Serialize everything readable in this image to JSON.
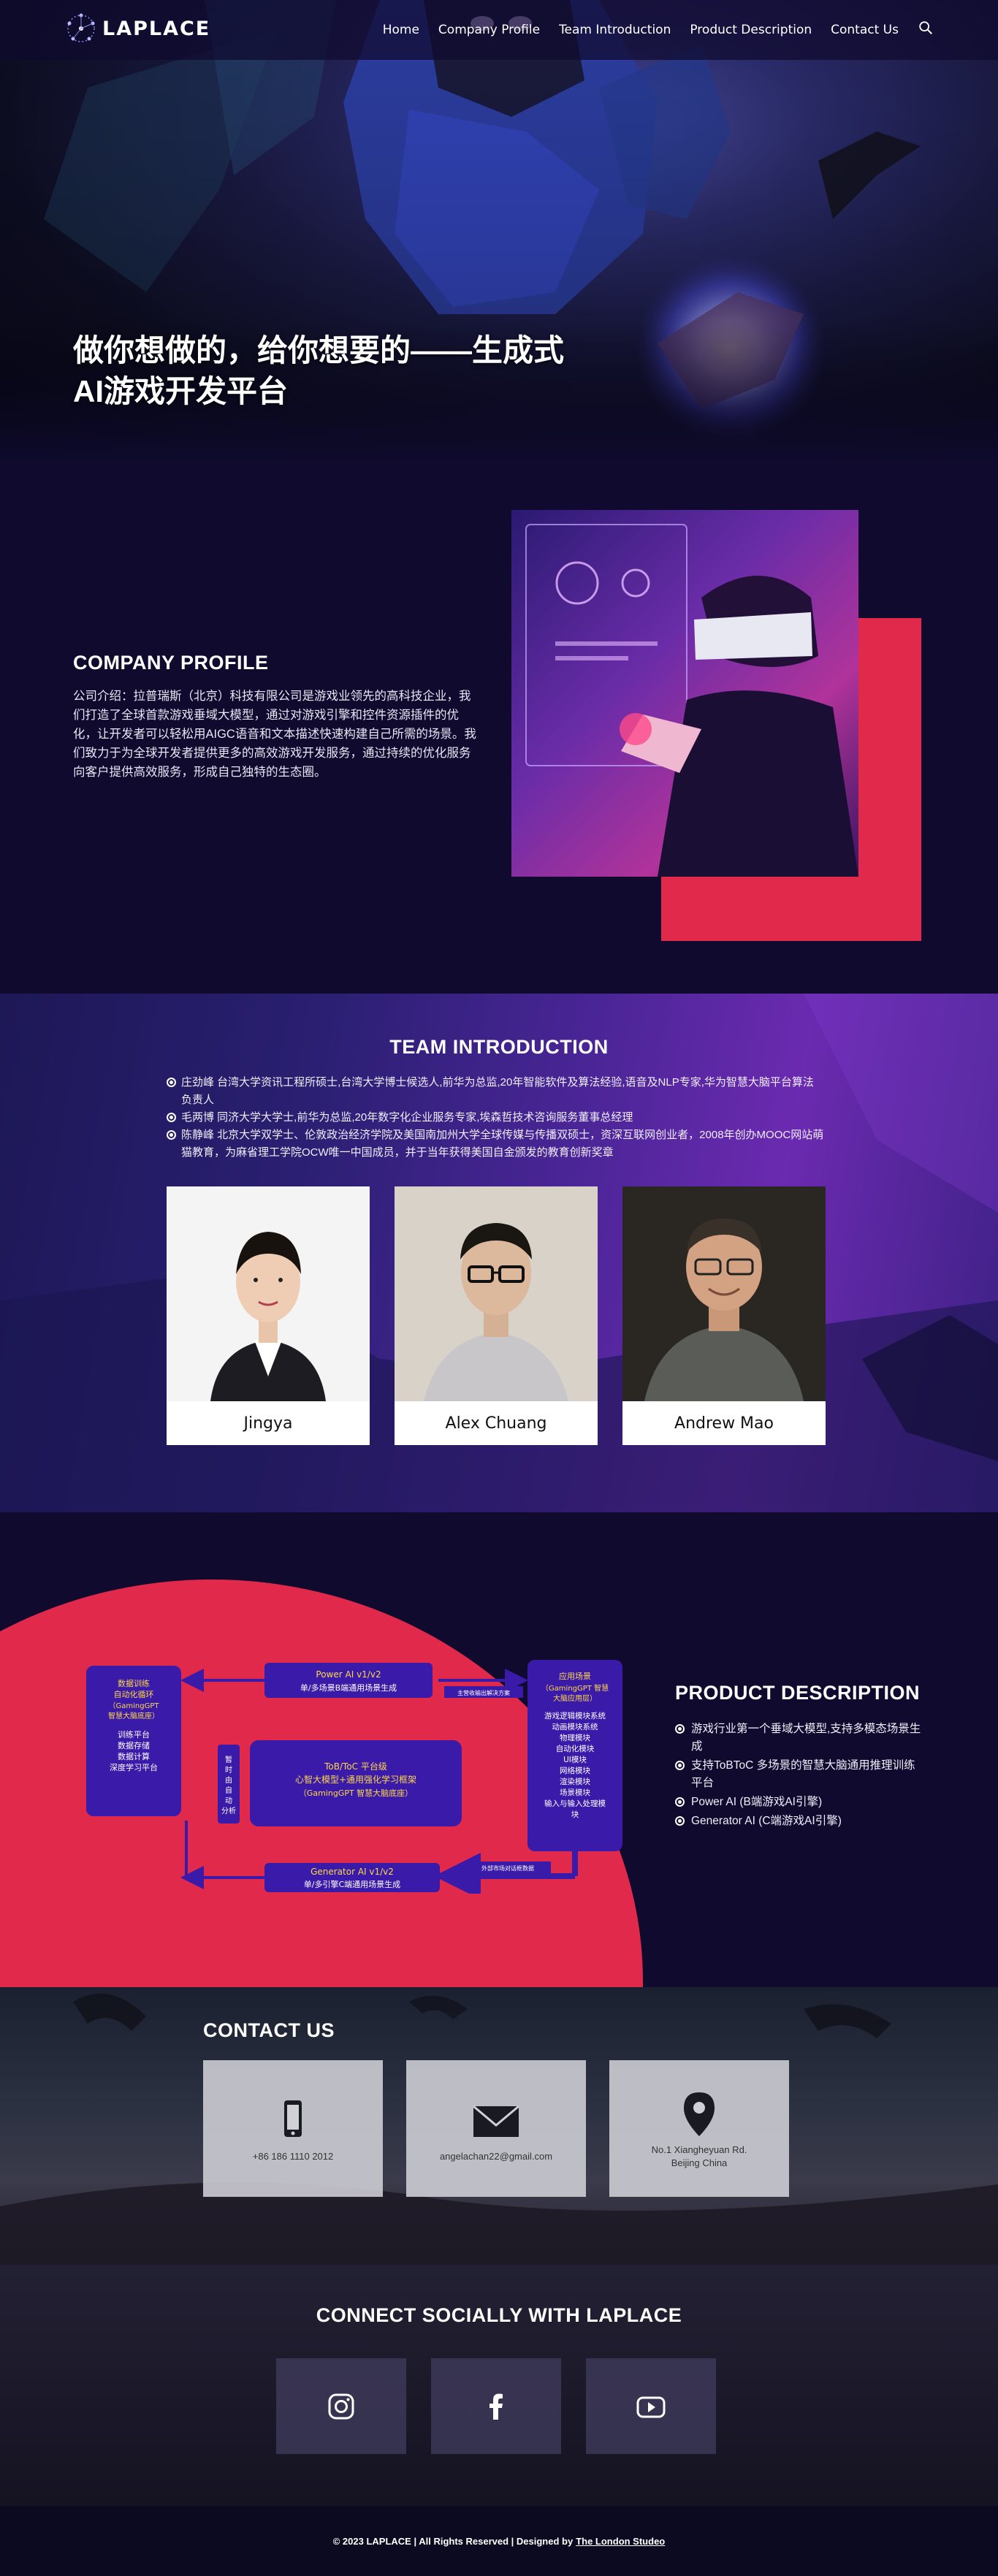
{
  "header": {
    "logo_text": "LAPLACE",
    "nav": [
      "Home",
      "Company Profile",
      "Team Introduction",
      "Product Description",
      "Contact Us"
    ],
    "search_icon": "search-icon"
  },
  "hero": {
    "title_line1": "做你想做的，给你想要的——生成式",
    "title_line2": "AI游戏开发平台"
  },
  "profile": {
    "title": "COMPANY PROFILE",
    "body": "公司介绍：拉普瑞斯（北京）科技有限公司是游戏业领先的高科技企业，我们打造了全球首款游戏垂域大模型，通过对游戏引擎和控件资源插件的优化，让开发者可以轻松用AIGC语音和文本描述快速构建自己所需的场景。我们致力于为全球开发者提供更多的高效游戏开发服务，通过持续的优化服务向客户提供高效服务，形成自己独特的生态圈。"
  },
  "team": {
    "title": "TEAM INTRODUCTION",
    "bios": [
      "庄劲峰 台湾大学资讯工程所硕士,台湾大学博士候选人,前华为总监,20年智能软件及算法经验,语音及NLP专家,华为智慧大脑平台算法负责人",
      "毛两博 同济大学大学士,前华为总监,20年数字化企业服务专家,埃森哲技术咨询服务董事总经理",
      "陈静峰 北京大学双学士、伦敦政治经济学院及美国南加州大学全球传媒与传播双硕士，资深互联网创业者，2008年创办MOOC网站萌猫教育，为麻省理工学院OCW唯一中国成员，并于当年获得美国自金颁发的教育创新奖章"
    ],
    "members": [
      {
        "name": "Jingya"
      },
      {
        "name": "Alex Chuang"
      },
      {
        "name": "Andrew Mao"
      }
    ]
  },
  "product": {
    "title": "PRODUCT DESCRIPTION",
    "items": [
      "游戏行业第一个垂域大模型,支持多模态场景生成",
      "支持ToBToC 多场景的智慧大脑通用推理训练平台",
      "Power AI (B端游戏AI引擎)",
      "Generator AI (C端游戏AI引擎)"
    ],
    "diagram": {
      "left_box": "数据训练\n自动化循环\n（GamingGPT\n智慧大脑底座）\n\n训练平台\n数据存储\n数据计算\n深度学习平台",
      "power_box": "Power AI v1/v2\n单/多场景B端通用场景生成",
      "center_box": "ToB/ToC 平台级\n心智大模型+通用强化学习框架\n（GamingGPT 智慧大脑底座）",
      "generator_box": "Generator AI v1/v2\n单/多引擎C端通用场景生成",
      "right_box": "应用场景\n（GamingGPT 智慧\n大脑应用层）\n\n游戏逻辑模块系统\n动画模块系统\n物理模块\n自动化模块\nUI模块\n网络模块\n渲染模块\n场景模块\n输入与输入处理模块",
      "side_label": "暂时由自动分析",
      "top_arrow_label": "主营收输出解决方案",
      "bottom_arrow_label": "外部市场对话框数据"
    }
  },
  "contact": {
    "title": "CONTACT US",
    "cards": [
      {
        "icon": "phone-icon",
        "text": "+86 186 1110 2012"
      },
      {
        "icon": "envelope-icon",
        "text": "angelachan22@gmail.com"
      },
      {
        "icon": "map-pin-icon",
        "text": "No.1 Xiangheyuan Rd.\nBeijing China"
      }
    ]
  },
  "social": {
    "title": "CONNECT SOCIALLY WITH LAPLACE",
    "icons": [
      "instagram-icon",
      "facebook-icon",
      "youtube-icon"
    ]
  },
  "footer": {
    "text": "© 2023 LAPLACE | All Rights Reserved | Designed by",
    "link": "The London Studeo"
  },
  "colors": {
    "background": "#0f0a2e",
    "accent_red": "#e0294b",
    "team_purple": "#4a2596"
  }
}
